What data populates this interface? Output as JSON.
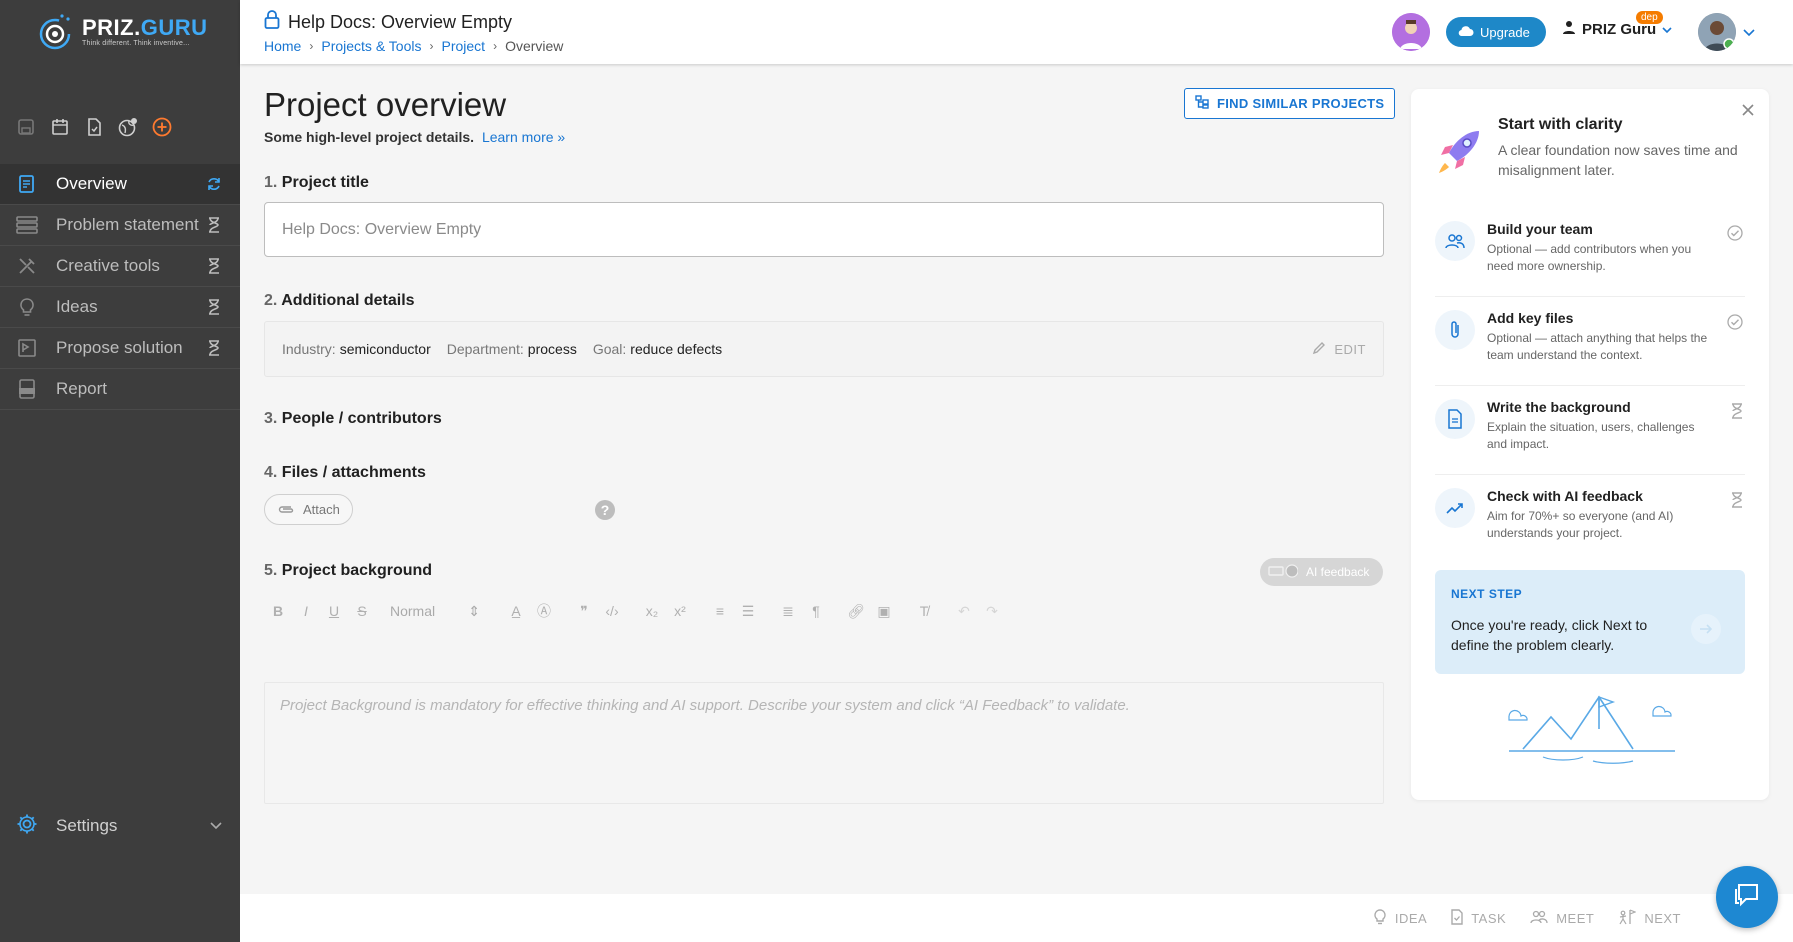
{
  "brand": {
    "name_part1": "PRIZ.",
    "name_part2": "GURU",
    "tagline": "Think different. Think inventive..."
  },
  "sidebar": {
    "items": [
      {
        "label": "Overview",
        "icon": "overview-icon",
        "status": "sync-icon",
        "active": true
      },
      {
        "label": "Problem statement",
        "icon": "problem-statement-icon",
        "status": "hourglass-icon"
      },
      {
        "label": "Creative tools",
        "icon": "tools-icon",
        "status": "hourglass-icon"
      },
      {
        "label": "Ideas",
        "icon": "lightbulb-icon",
        "status": "hourglass-icon"
      },
      {
        "label": "Propose solution",
        "icon": "propose-solution-icon",
        "status": "hourglass-icon"
      },
      {
        "label": "Report",
        "icon": "report-pdf-icon",
        "status": ""
      }
    ],
    "settings_label": "Settings"
  },
  "header": {
    "title": "Help Docs: Overview Empty",
    "breadcrumb": [
      "Home",
      "Projects & Tools",
      "Project",
      "Overview"
    ],
    "upgrade_label": "Upgrade",
    "user_name": "PRIZ Guru",
    "dep_badge": "dep"
  },
  "main": {
    "page_title": "Project overview",
    "subtitle": "Some high-level project details.",
    "learn_more": "Learn more »",
    "find_similar_label": "FIND SIMILAR PROJECTS",
    "sections": {
      "s1_num": "1.",
      "s1_label": "Project title",
      "s2_num": "2.",
      "s2_label": "Additional details",
      "s3_num": "3.",
      "s3_label": "People / contributors",
      "s4_num": "4.",
      "s4_label": "Files / attachments",
      "s5_num": "5.",
      "s5_label": "Project background"
    },
    "title_value": "Help Docs: Overview Empty",
    "details": {
      "industry_key": "Industry:",
      "industry_val": "semiconductor",
      "department_key": "Department:",
      "department_val": "process",
      "goal_key": "Goal:",
      "goal_val": "reduce defects",
      "edit_label": "EDIT"
    },
    "attach_label": "Attach",
    "help_glyph": "?",
    "ai_feedback_label": "AI feedback",
    "editor": {
      "format_select": "Normal",
      "placeholder": "Project Background is mandatory for effective thinking and AI support. Describe your system and click “AI Feedback” to validate."
    }
  },
  "panel": {
    "heading": "Start with clarity",
    "description": "A clear foundation now saves time and misalignment later.",
    "steps": [
      {
        "title": "Build your team",
        "desc": "Optional — add contributors when you need more ownership.",
        "status": "check-circle-icon"
      },
      {
        "title": "Add key files",
        "desc": "Optional — attach anything that helps the team understand the context.",
        "status": "check-circle-icon"
      },
      {
        "title": "Write the background",
        "desc": "Explain the situation, users, challenges and impact.",
        "status": "hourglass-icon"
      },
      {
        "title": "Check with AI feedback",
        "desc": "Aim for 70%+ so everyone (and AI) understands your project.",
        "status": "hourglass-icon"
      }
    ],
    "next_step_label": "NEXT STEP",
    "next_step_text": "Once you're ready, click Next to define the problem clearly."
  },
  "bottombar": {
    "idea": "IDEA",
    "task": "TASK",
    "meet": "MEET",
    "next": "NEXT"
  },
  "colors": {
    "sidebar_bg": "#3d3d3d",
    "accent": "#1976d2",
    "upgrade_bg": "#1e88c8",
    "badge": "#f57c00"
  }
}
